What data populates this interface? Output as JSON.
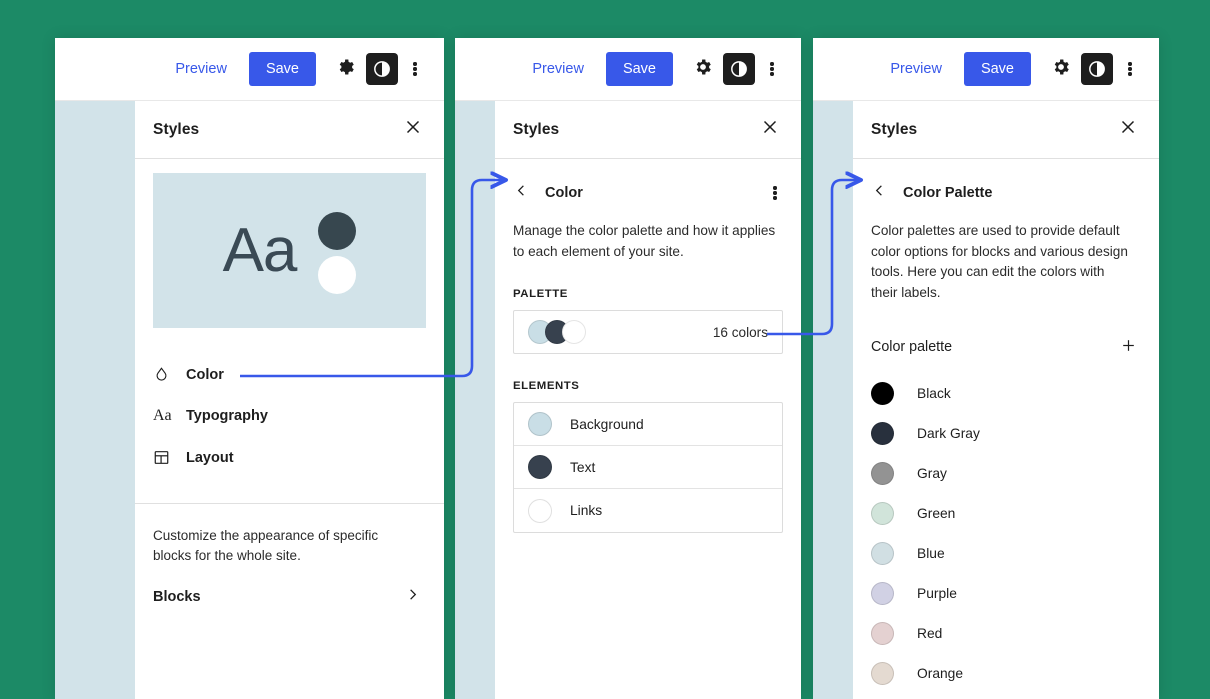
{
  "theme": {
    "background_green": "#1c8a66",
    "canvas_blue": "#d2e3e9",
    "accent_blue": "#3858e9",
    "text_dark": "#1e1e1e"
  },
  "toolbar": {
    "preview_label": "Preview",
    "save_label": "Save",
    "settings_icon": "gear-icon",
    "styles_icon": "contrast-icon",
    "more_icon": "kebab-menu-icon"
  },
  "panel1": {
    "header": {
      "title": "Styles",
      "close_icon": "close-icon"
    },
    "preview_card": {
      "sample_text": "Aa",
      "dot_top_color": "#37474f",
      "dot_bottom_color": "#ffffff",
      "background": "#d2e3e9"
    },
    "nav_items": [
      {
        "label": "Color",
        "icon": "droplet-icon"
      },
      {
        "label": "Typography",
        "icon": "typography-icon"
      },
      {
        "label": "Layout",
        "icon": "layout-icon"
      }
    ],
    "blocks": {
      "description": "Customize the appearance of specific blocks for the whole site.",
      "label": "Blocks",
      "chevron_icon": "chevron-right-icon"
    }
  },
  "panel2": {
    "header": {
      "title": "Styles",
      "close_icon": "close-icon"
    },
    "nav": {
      "back_icon": "chevron-left-icon",
      "title": "Color",
      "more_icon": "kebab-menu-icon"
    },
    "description": "Manage the color palette and how it applies to each element of your site.",
    "palette_section_label": "PALETTE",
    "palette_row": {
      "count_label": "16 colors",
      "swatches": [
        "#c9dee6",
        "#37414e",
        "#ffffff"
      ]
    },
    "elements_section_label": "ELEMENTS",
    "elements": [
      {
        "label": "Background",
        "color": "#c9dee6"
      },
      {
        "label": "Text",
        "color": "#37414e"
      },
      {
        "label": "Links",
        "color": "#ffffff"
      }
    ]
  },
  "panel3": {
    "header": {
      "title": "Styles",
      "close_icon": "close-icon"
    },
    "nav": {
      "back_icon": "chevron-left-icon",
      "title": "Color Palette"
    },
    "description": "Color palettes are used to provide default color options for blocks and various design tools. Here you can edit the colors with their labels.",
    "palette_heading": "Color palette",
    "add_icon": "plus-icon",
    "colors": [
      {
        "label": "Black",
        "color": "#000000"
      },
      {
        "label": "Dark Gray",
        "color": "#28303d"
      },
      {
        "label": "Gray",
        "color": "#939393"
      },
      {
        "label": "Green",
        "color": "#d1e4da"
      },
      {
        "label": "Blue",
        "color": "#d1dfe3"
      },
      {
        "label": "Purple",
        "color": "#d1d1e4"
      },
      {
        "label": "Red",
        "color": "#e4d1d1"
      },
      {
        "label": "Orange",
        "color": "#e4dad1"
      }
    ]
  },
  "connectors": [
    {
      "from": "panel1-color-row",
      "to": "panel2-back-chevron"
    },
    {
      "from": "panel2-palette-row",
      "to": "panel3-back-chevron"
    }
  ]
}
